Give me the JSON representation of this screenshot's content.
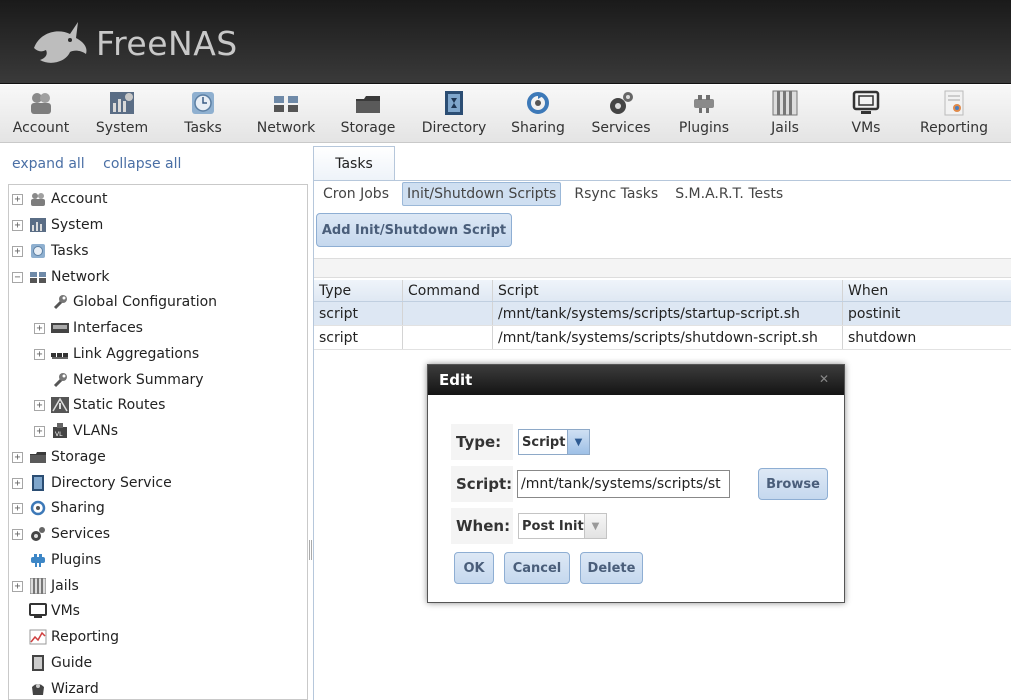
{
  "app": {
    "logo_text": "FreeNAS"
  },
  "toolbar": {
    "items": [
      {
        "label": "Account",
        "icon": "account-icon"
      },
      {
        "label": "System",
        "icon": "system-icon"
      },
      {
        "label": "Tasks",
        "icon": "tasks-icon"
      },
      {
        "label": "Network",
        "icon": "network-icon"
      },
      {
        "label": "Storage",
        "icon": "storage-icon"
      },
      {
        "label": "Directory",
        "icon": "directory-icon"
      },
      {
        "label": "Sharing",
        "icon": "sharing-icon"
      },
      {
        "label": "Services",
        "icon": "services-icon"
      },
      {
        "label": "Plugins",
        "icon": "plugins-icon"
      },
      {
        "label": "Jails",
        "icon": "jails-icon"
      },
      {
        "label": "VMs",
        "icon": "vms-icon"
      },
      {
        "label": "Reporting",
        "icon": "reporting-icon"
      }
    ]
  },
  "sidebar": {
    "expand_all": "expand all",
    "collapse_all": "collapse all",
    "items": [
      {
        "label": "Account",
        "expander": "+"
      },
      {
        "label": "System",
        "expander": "+"
      },
      {
        "label": "Tasks",
        "expander": "+"
      },
      {
        "label": "Network",
        "expander": "−"
      },
      {
        "label": "Global Configuration",
        "expander": ""
      },
      {
        "label": "Interfaces",
        "expander": "+"
      },
      {
        "label": "Link Aggregations",
        "expander": "+"
      },
      {
        "label": "Network Summary",
        "expander": ""
      },
      {
        "label": "Static Routes",
        "expander": "+"
      },
      {
        "label": "VLANs",
        "expander": "+"
      },
      {
        "label": "Storage",
        "expander": "+"
      },
      {
        "label": "Directory Service",
        "expander": "+"
      },
      {
        "label": "Sharing",
        "expander": "+"
      },
      {
        "label": "Services",
        "expander": "+"
      },
      {
        "label": "Plugins",
        "expander": ""
      },
      {
        "label": "Jails",
        "expander": "+"
      },
      {
        "label": "VMs",
        "expander": ""
      },
      {
        "label": "Reporting",
        "expander": ""
      },
      {
        "label": "Guide",
        "expander": ""
      },
      {
        "label": "Wizard",
        "expander": ""
      }
    ]
  },
  "main": {
    "tab": "Tasks",
    "subtabs": [
      "Cron Jobs",
      "Init/Shutdown Scripts",
      "Rsync Tasks",
      "S.M.A.R.T. Tests"
    ],
    "active_subtab": "Init/Shutdown Scripts",
    "add_button": "Add Init/Shutdown Script",
    "grid": {
      "columns": [
        "Type",
        "Command",
        "Script",
        "When"
      ],
      "rows": [
        [
          "script",
          "",
          "/mnt/tank/systems/scripts/startup-script.sh",
          "postinit"
        ],
        [
          "script",
          "",
          "/mnt/tank/systems/scripts/shutdown-script.sh",
          "shutdown"
        ]
      ]
    }
  },
  "dialog": {
    "title": "Edit",
    "type_label": "Type:",
    "type_value": "Script",
    "script_label": "Script:",
    "script_value": "/mnt/tank/systems/scripts/st",
    "when_label": "When:",
    "when_value": "Post Init",
    "browse": "Browse",
    "ok": "OK",
    "cancel": "Cancel",
    "delete": "Delete"
  }
}
